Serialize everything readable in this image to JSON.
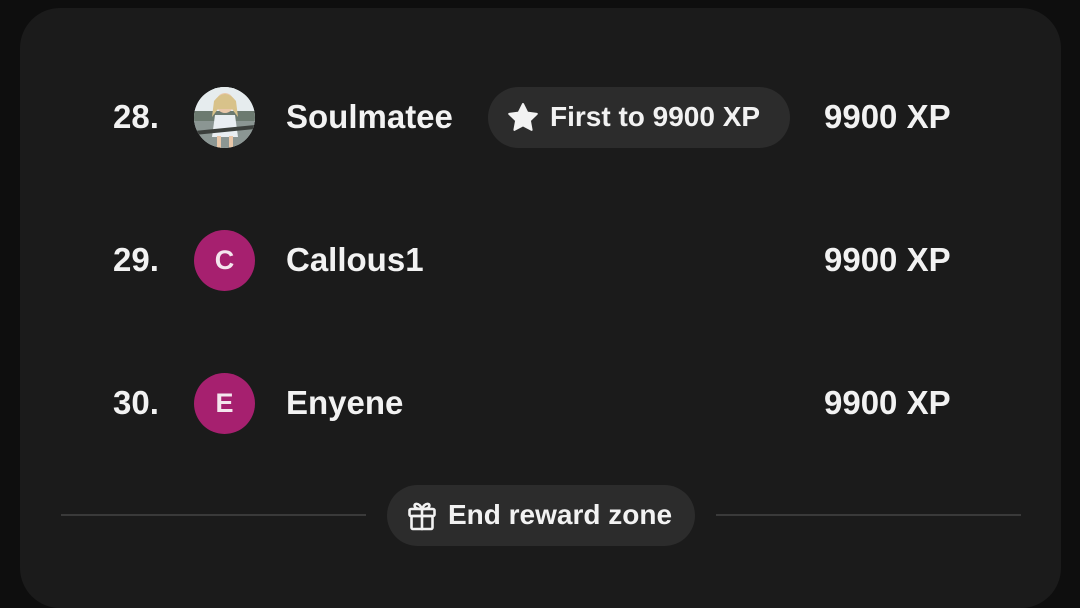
{
  "leaderboard": {
    "rows": [
      {
        "rank": "28.",
        "avatar_type": "photo",
        "avatar_initial": "",
        "name": "Soulmatee",
        "badge": {
          "icon": "star-icon",
          "label": "First to 9900 XP"
        },
        "xp": "9900 XP"
      },
      {
        "rank": "29.",
        "avatar_type": "initial",
        "avatar_initial": "C",
        "name": "Callous1",
        "xp": "9900 XP"
      },
      {
        "rank": "30.",
        "avatar_type": "initial",
        "avatar_initial": "E",
        "name": "Enyene",
        "xp": "9900 XP"
      }
    ]
  },
  "reward_zone": {
    "icon": "gift-icon",
    "label": "End reward zone"
  },
  "colors": {
    "background": "#0e0e0e",
    "card": "#1b1b1b",
    "pill": "#2c2c2c",
    "avatar_accent": "#a6206f",
    "text": "#f2f2f2"
  }
}
